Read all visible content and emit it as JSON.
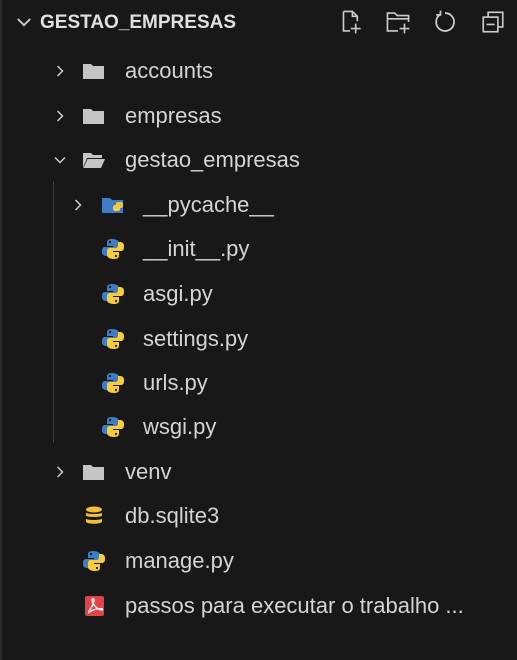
{
  "explorer": {
    "title": "GESTAO_EMPRESAS",
    "actions": [
      {
        "name": "new-file",
        "icon": "new-file-icon"
      },
      {
        "name": "new-folder",
        "icon": "new-folder-icon"
      },
      {
        "name": "refresh",
        "icon": "refresh-icon"
      },
      {
        "name": "collapse-all",
        "icon": "collapse-all-icon"
      }
    ],
    "items": [
      {
        "label": "accounts",
        "type": "folder",
        "expanded": false
      },
      {
        "label": "empresas",
        "type": "folder",
        "expanded": false
      },
      {
        "label": "gestao_empresas",
        "type": "folder",
        "expanded": true
      },
      {
        "label": "__pycache__",
        "type": "folder-python",
        "expanded": false
      },
      {
        "label": "__init__.py",
        "type": "python"
      },
      {
        "label": "asgi.py",
        "type": "python"
      },
      {
        "label": "settings.py",
        "type": "python"
      },
      {
        "label": "urls.py",
        "type": "python"
      },
      {
        "label": "wsgi.py",
        "type": "python"
      },
      {
        "label": "venv",
        "type": "folder",
        "expanded": false
      },
      {
        "label": "db.sqlite3",
        "type": "database"
      },
      {
        "label": "manage.py",
        "type": "python"
      },
      {
        "label": "passos para executar o trabalho ...",
        "type": "pdf"
      }
    ]
  },
  "colors": {
    "background": "#181818",
    "folder": "#c5c5c5",
    "python_blue": "#3f7cc4",
    "python_yellow": "#f7cd3b",
    "database": "#f2c037",
    "pdf": "#e2424a"
  }
}
